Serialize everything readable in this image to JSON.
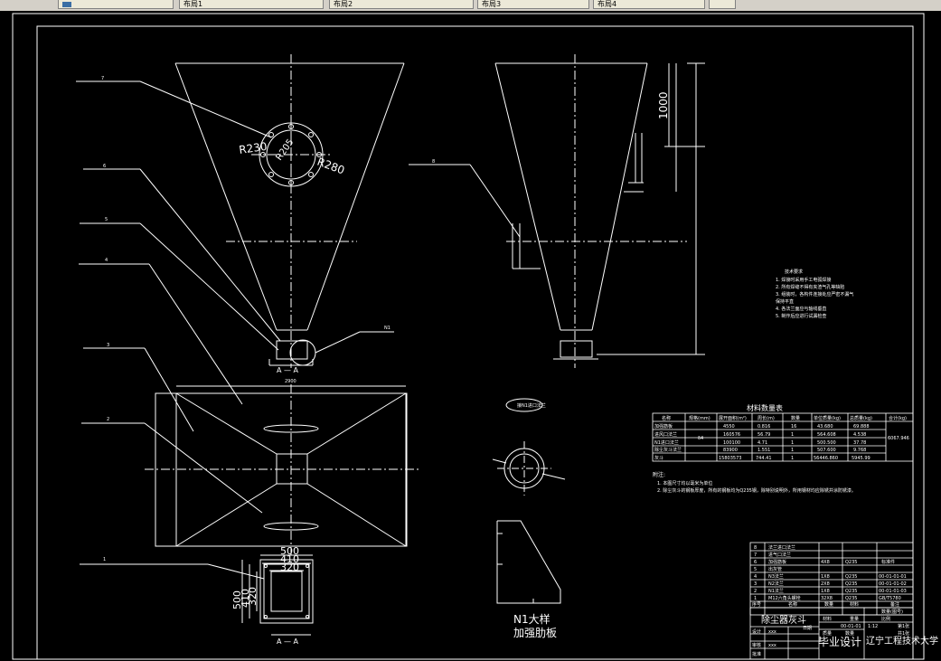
{
  "tabs": [
    {
      "label": ""
    },
    {
      "label": "布局1"
    },
    {
      "label": "布局2"
    },
    {
      "label": "布局3"
    },
    {
      "label": "布局4"
    },
    {
      "label": ""
    }
  ],
  "drawing": {
    "dims": {
      "r230": "R230",
      "r280": "R280",
      "r205": "R205",
      "d1000": "1000",
      "d2900": "2900",
      "d500w": "500",
      "d410w": "410",
      "d320w": "320",
      "d500h": "500",
      "d410h": "410",
      "d320h": "320",
      "aa1": "A — A",
      "aa2": "A — A",
      "n1": "N1"
    },
    "labels": {
      "n1_title": "N1大样",
      "n1_sub": "加强肋板",
      "detail_note": "接N1进口法兰"
    },
    "balloons": [
      "7",
      "6",
      "5",
      "4",
      "3",
      "2",
      "1",
      "8"
    ],
    "notes_title": "技术要求",
    "notes": [
      "1. 焊接时采用手工电弧焊接",
      "2. 所有焊缝不得有夹渣气孔等缺陷",
      "3. 组装时，各构件连接处应严密不漏气",
      "   保持平直",
      "4. 各法兰面应与轴线垂直",
      "5. 制作后应进行试漏检查"
    ],
    "material": {
      "title": "材料数量表",
      "headers": [
        "名称",
        "规格(mm)",
        "展开面积(m²)",
        "周长(m)",
        "数量",
        "单位质量(kg)",
        "总质量(kg)",
        "合计(kg)"
      ],
      "rows": [
        [
          "加强筋板",
          "",
          "4550",
          "0.816",
          "16",
          "43.680",
          "69.888",
          ""
        ],
        [
          "进风口法兰",
          "",
          "160576",
          "56.79",
          "1",
          "564.608",
          "4.538",
          ""
        ],
        [
          "N1进口法兰",
          "δ4",
          "100100",
          "4.71",
          "1",
          "500.500",
          "37.78",
          "6067.946"
        ],
        [
          "除尘灰斗法兰",
          "",
          "83900",
          "1.551",
          "1",
          "507.600",
          "9.768",
          ""
        ],
        [
          "灰斗",
          "",
          "15803573",
          "744.41",
          "1",
          "56446.860",
          "5945.99",
          ""
        ]
      ]
    },
    "remarks_title": "附注:",
    "remarks": [
      "1. 本图尺寸均以毫米为单位",
      "2. 除尘灰斗的钢板厚度，所有的钢板均为Q235钢，除特别说明外，所用钢材均应除锈并涂防锈漆。"
    ],
    "bom": [
      [
        "8",
        "法兰进口法兰",
        "",
        "",
        "",
        ""
      ],
      [
        "7",
        "进气口法兰",
        "",
        "",
        "",
        ""
      ],
      [
        "6",
        "加强筋板",
        "4X8",
        "Q235",
        "",
        "标准件"
      ],
      [
        "5",
        "出灰管",
        "",
        "",
        "",
        ""
      ],
      [
        "4",
        "N3法兰",
        "1X8",
        "Q235",
        "",
        "00-01-01-01"
      ],
      [
        "3",
        "N2法兰",
        "2X8",
        "Q235",
        "",
        "00-01-01-02"
      ],
      [
        "2",
        "N1法兰",
        "1X8",
        "Q235",
        "",
        "00-01-01-03"
      ],
      [
        "1",
        "M12六角头螺栓",
        "32X8",
        "Q235",
        "",
        "GB/T5780"
      ]
    ],
    "bom_header": [
      "序号",
      "名称",
      "数量",
      "材料",
      "",
      "备注"
    ],
    "title_block": {
      "part_name": "除尘器灰斗",
      "thesis": "毕业设计",
      "school": "辽宁工程技术大学",
      "scale_label": "比例",
      "scale": "1:12",
      "sheet_label": "第1张",
      "sheets": "共1张",
      "drawing_no": "00-01-01",
      "mass_label": "质量",
      "qty_label": "数量",
      "designer_label": "设计",
      "checker_label": "审核",
      "approver_label": "批准",
      "date_label": "日期",
      "designer": "xxx",
      "checker": "xxx",
      "drawer_label": "描图",
      "process_label": "工艺",
      "qty_field": "数量(图号)",
      "material_field": "材料",
      "weight_field": "重量"
    }
  }
}
